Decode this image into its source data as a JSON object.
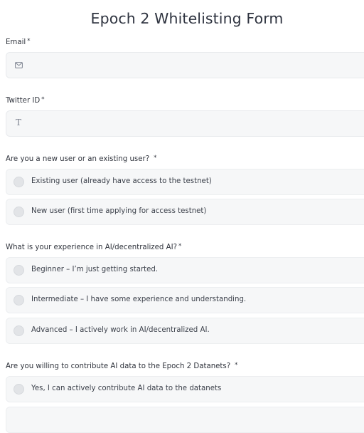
{
  "form": {
    "title": "Epoch 2 Whitelisting Form",
    "required_mark": "*"
  },
  "email": {
    "label": "Email",
    "icon": "mail-icon",
    "value": ""
  },
  "twitter": {
    "label": "Twitter ID",
    "icon": "text-icon",
    "icon_glyph": "T",
    "value": ""
  },
  "q_user_type": {
    "label": "Are you a new user or an existing user?",
    "options": [
      "Existing user (already have access to the testnet)",
      "New user (first time applying for access testnet)"
    ]
  },
  "q_experience": {
    "label": "What is your experience in AI/decentralized AI?",
    "options": [
      "Beginner – I’m just getting started.",
      "Intermediate – I have some experience and understanding.",
      "Advanced – I actively work in AI/decentralized AI."
    ]
  },
  "q_contribute": {
    "label": "Are you willing to contribute AI data to the Epoch 2 Datanets?",
    "options": [
      "Yes, I can actively contribute AI data to the datanets"
    ]
  }
}
